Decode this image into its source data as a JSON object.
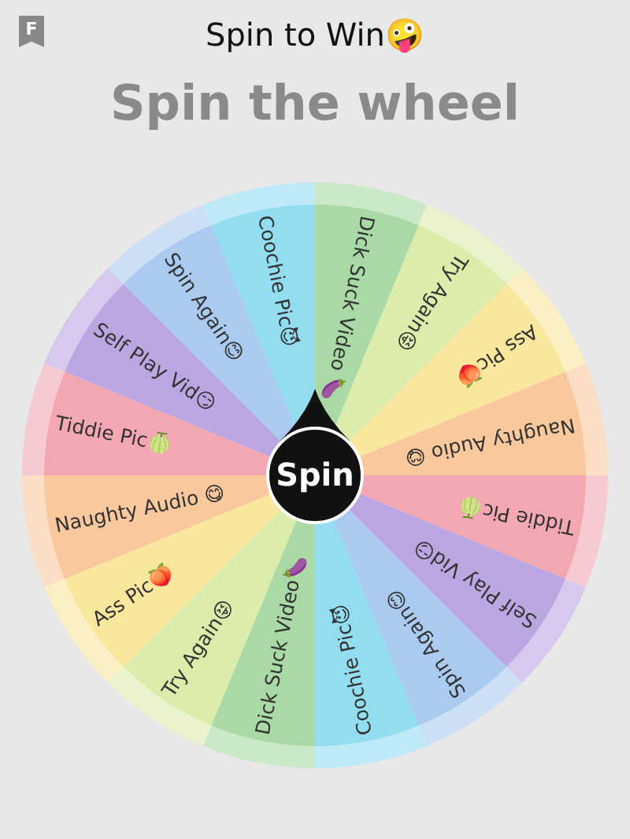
{
  "header": {
    "badge": "F",
    "title": "Spin to Win🤪"
  },
  "heading": "Spin the wheel",
  "wheel": {
    "segments": [
      {
        "label": "Dick Suck Video 🍆",
        "color": "#a9d9a4"
      },
      {
        "label": "Try Again😝",
        "color": "#dcecab"
      },
      {
        "label": "Ass Pic🍑",
        "color": "#f8e79c"
      },
      {
        "label": "Naughty Audio 😋",
        "color": "#f9c99d"
      },
      {
        "label": "Tiddie Pic🍈",
        "color": "#f2a7b3"
      },
      {
        "label": "Self Play Vid😏",
        "color": "#bba6e2"
      },
      {
        "label": "Spin Again😊",
        "color": "#abcaef"
      },
      {
        "label": "Coochie Pic😈",
        "color": "#92ddf0"
      },
      {
        "label": "Dick Suck Video🍆",
        "color": "#a9d9a4"
      },
      {
        "label": "Try Again😝",
        "color": "#dcecab"
      },
      {
        "label": "Ass Pic🍑",
        "color": "#f8e79c"
      },
      {
        "label": "Naughty Audio 😋",
        "color": "#f9c99d"
      },
      {
        "label": "Tiddie Pic🍈",
        "color": "#f2a7b3"
      },
      {
        "label": "Self Play Vid😏",
        "color": "#bba6e2"
      },
      {
        "label": "Spin Again😊",
        "color": "#abcaef"
      },
      {
        "label": "Coochie Pic😈",
        "color": "#92ddf0"
      }
    ],
    "spin_button": "Spin"
  }
}
